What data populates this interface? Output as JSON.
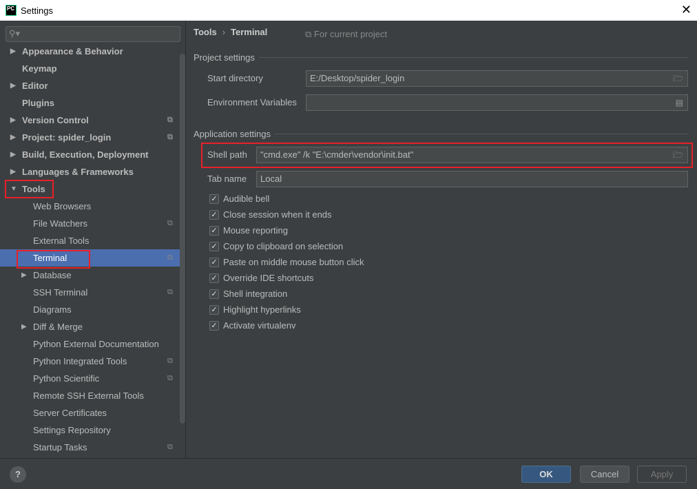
{
  "window": {
    "title": "Settings",
    "logo": "PC"
  },
  "search": {
    "placeholder": ""
  },
  "sidebar": {
    "items": [
      {
        "label": "Appearance & Behavior",
        "level": 0,
        "arrow": "right",
        "bold": true
      },
      {
        "label": "Keymap",
        "level": 0,
        "bold": true
      },
      {
        "label": "Editor",
        "level": 0,
        "arrow": "right",
        "bold": true
      },
      {
        "label": "Plugins",
        "level": 0,
        "bold": true
      },
      {
        "label": "Version Control",
        "level": 0,
        "arrow": "right",
        "bold": true,
        "icon": true
      },
      {
        "label": "Project: spider_login",
        "level": 0,
        "arrow": "right",
        "bold": true,
        "icon": true
      },
      {
        "label": "Build, Execution, Deployment",
        "level": 0,
        "arrow": "right",
        "bold": true
      },
      {
        "label": "Languages & Frameworks",
        "level": 0,
        "arrow": "right",
        "bold": true
      },
      {
        "label": "Tools",
        "level": 0,
        "arrow": "down",
        "bold": true
      },
      {
        "label": "Web Browsers",
        "level": 1
      },
      {
        "label": "File Watchers",
        "level": 1,
        "icon": true
      },
      {
        "label": "External Tools",
        "level": 1
      },
      {
        "label": "Terminal",
        "level": 1,
        "icon": true,
        "selected": true
      },
      {
        "label": "Database",
        "level": 1,
        "arrow": "right"
      },
      {
        "label": "SSH Terminal",
        "level": 1,
        "icon": true
      },
      {
        "label": "Diagrams",
        "level": 1
      },
      {
        "label": "Diff & Merge",
        "level": 1,
        "arrow": "right"
      },
      {
        "label": "Python External Documentation",
        "level": 1
      },
      {
        "label": "Python Integrated Tools",
        "level": 1,
        "icon": true
      },
      {
        "label": "Python Scientific",
        "level": 1,
        "icon": true
      },
      {
        "label": "Remote SSH External Tools",
        "level": 1
      },
      {
        "label": "Server Certificates",
        "level": 1
      },
      {
        "label": "Settings Repository",
        "level": 1
      },
      {
        "label": "Startup Tasks",
        "level": 1,
        "icon": true
      }
    ]
  },
  "breadcrumb": {
    "parent": "Tools",
    "sep": "›",
    "current": "Terminal"
  },
  "scope": "For current project",
  "project_settings": {
    "title": "Project settings",
    "start_directory_label": "Start directory",
    "start_directory": "E:/Desktop/spider_login",
    "env_label": "Environment Variables",
    "env_value": ""
  },
  "app_settings": {
    "title": "Application settings",
    "shell_path_label": "Shell path",
    "shell_path": "\"cmd.exe\" /k \"E:\\cmder\\vendor\\init.bat\"",
    "tab_name_label": "Tab name",
    "tab_name": "Local"
  },
  "checkboxes": [
    {
      "label": "Audible bell",
      "checked": true
    },
    {
      "label": "Close session when it ends",
      "checked": true
    },
    {
      "label": "Mouse reporting",
      "checked": true
    },
    {
      "label": "Copy to clipboard on selection",
      "checked": true
    },
    {
      "label": "Paste on middle mouse button click",
      "checked": true
    },
    {
      "label": "Override IDE shortcuts",
      "checked": true
    },
    {
      "label": "Shell integration",
      "checked": true
    },
    {
      "label": "Highlight hyperlinks",
      "checked": true
    },
    {
      "label": "Activate virtualenv",
      "checked": true
    }
  ],
  "buttons": {
    "help": "?",
    "ok": "OK",
    "cancel": "Cancel",
    "apply": "Apply"
  },
  "colors": {
    "selection": "#4b6eaf",
    "highlight_box": "#e8202a",
    "ok_button": "#365880"
  }
}
